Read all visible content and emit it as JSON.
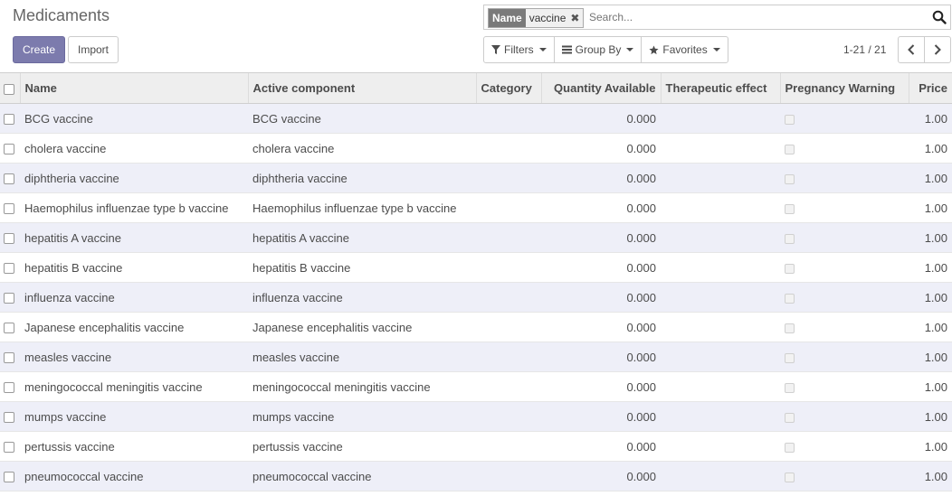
{
  "header": {
    "title": "Medicaments",
    "create_label": "Create",
    "import_label": "Import"
  },
  "search": {
    "facet_label": "Name",
    "facet_value": "vaccine",
    "placeholder": "Search..."
  },
  "filters": {
    "filters_label": "Filters",
    "group_by_label": "Group By",
    "favorites_label": "Favorites"
  },
  "pager": {
    "value": "1-21 / 21"
  },
  "icons": {
    "search": "search-icon",
    "filter": "filter-icon",
    "group": "list-icon",
    "favorites": "star-icon",
    "prev": "chevron-left-icon",
    "next": "chevron-right-icon",
    "remove": "close-icon"
  },
  "table": {
    "columns": [
      "Name",
      "Active component",
      "Category",
      "Quantity Available",
      "Therapeutic effect",
      "Pregnancy Warning",
      "Price"
    ],
    "rows": [
      {
        "name": "BCG vaccine",
        "active": "BCG vaccine",
        "category": "",
        "qty": "0.000",
        "effect": "",
        "price": "1.00"
      },
      {
        "name": "cholera vaccine",
        "active": "cholera vaccine",
        "category": "",
        "qty": "0.000",
        "effect": "",
        "price": "1.00"
      },
      {
        "name": "diphtheria vaccine",
        "active": "diphtheria vaccine",
        "category": "",
        "qty": "0.000",
        "effect": "",
        "price": "1.00"
      },
      {
        "name": "Haemophilus influenzae type b vaccine",
        "active": "Haemophilus influenzae type b vaccine",
        "category": "",
        "qty": "0.000",
        "effect": "",
        "price": "1.00"
      },
      {
        "name": "hepatitis A vaccine",
        "active": "hepatitis A vaccine",
        "category": "",
        "qty": "0.000",
        "effect": "",
        "price": "1.00"
      },
      {
        "name": "hepatitis B vaccine",
        "active": "hepatitis B vaccine",
        "category": "",
        "qty": "0.000",
        "effect": "",
        "price": "1.00"
      },
      {
        "name": "influenza vaccine",
        "active": "influenza vaccine",
        "category": "",
        "qty": "0.000",
        "effect": "",
        "price": "1.00"
      },
      {
        "name": "Japanese encephalitis vaccine",
        "active": "Japanese encephalitis vaccine",
        "category": "",
        "qty": "0.000",
        "effect": "",
        "price": "1.00"
      },
      {
        "name": "measles vaccine",
        "active": "measles vaccine",
        "category": "",
        "qty": "0.000",
        "effect": "",
        "price": "1.00"
      },
      {
        "name": "meningococcal meningitis vaccine",
        "active": "meningococcal meningitis vaccine",
        "category": "",
        "qty": "0.000",
        "effect": "",
        "price": "1.00"
      },
      {
        "name": "mumps vaccine",
        "active": "mumps vaccine",
        "category": "",
        "qty": "0.000",
        "effect": "",
        "price": "1.00"
      },
      {
        "name": "pertussis vaccine",
        "active": "pertussis vaccine",
        "category": "",
        "qty": "0.000",
        "effect": "",
        "price": "1.00"
      },
      {
        "name": "pneumococcal vaccine",
        "active": "pneumococcal vaccine",
        "category": "",
        "qty": "0.000",
        "effect": "",
        "price": "1.00"
      }
    ]
  }
}
